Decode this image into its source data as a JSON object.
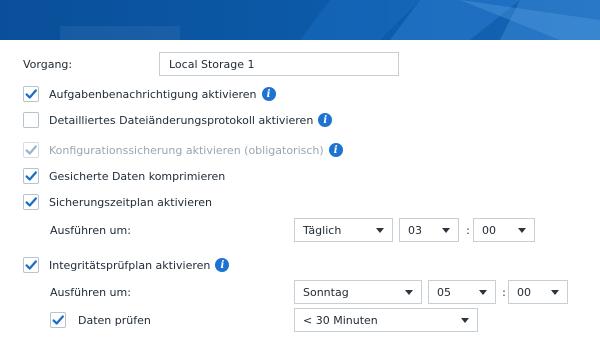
{
  "form": {
    "task_label": "Vorgang:",
    "task_value": "Local Storage 1",
    "options": {
      "notify": "Aufgabenbenachrichtigung aktivieren",
      "detailed_log": "Detailliertes Dateiänderungsprotokoll aktivieren",
      "config_backup": "Konfigurationssicherung aktivieren (obligatorisch)",
      "compress": "Gesicherte Daten komprimieren",
      "schedule": "Sicherungszeitplan aktivieren",
      "integrity": "Integritätsprüfplan aktivieren",
      "verify": "Daten prüfen"
    },
    "checked": {
      "notify": true,
      "detailed_log": false,
      "config_backup": true,
      "compress": true,
      "schedule": true,
      "integrity": true,
      "verify": true
    },
    "schedule": {
      "run_label": "Ausführen um:",
      "frequency": "Täglich",
      "hour": "03",
      "minute": "00"
    },
    "integrity": {
      "run_label": "Ausführen um:",
      "frequency": "Sonntag",
      "hour": "05",
      "minute": "00",
      "verify_duration": "< 30 Minuten"
    },
    "separator": ":"
  },
  "icons": {
    "check": "checkmark-icon",
    "info": "info-icon",
    "dropdown": "chevron-down-icon"
  },
  "colors": {
    "banner": "#0c5aa8",
    "check": "#1a6fc4",
    "check_disabled": "#9ab3cf",
    "info": "#1e73d2"
  }
}
